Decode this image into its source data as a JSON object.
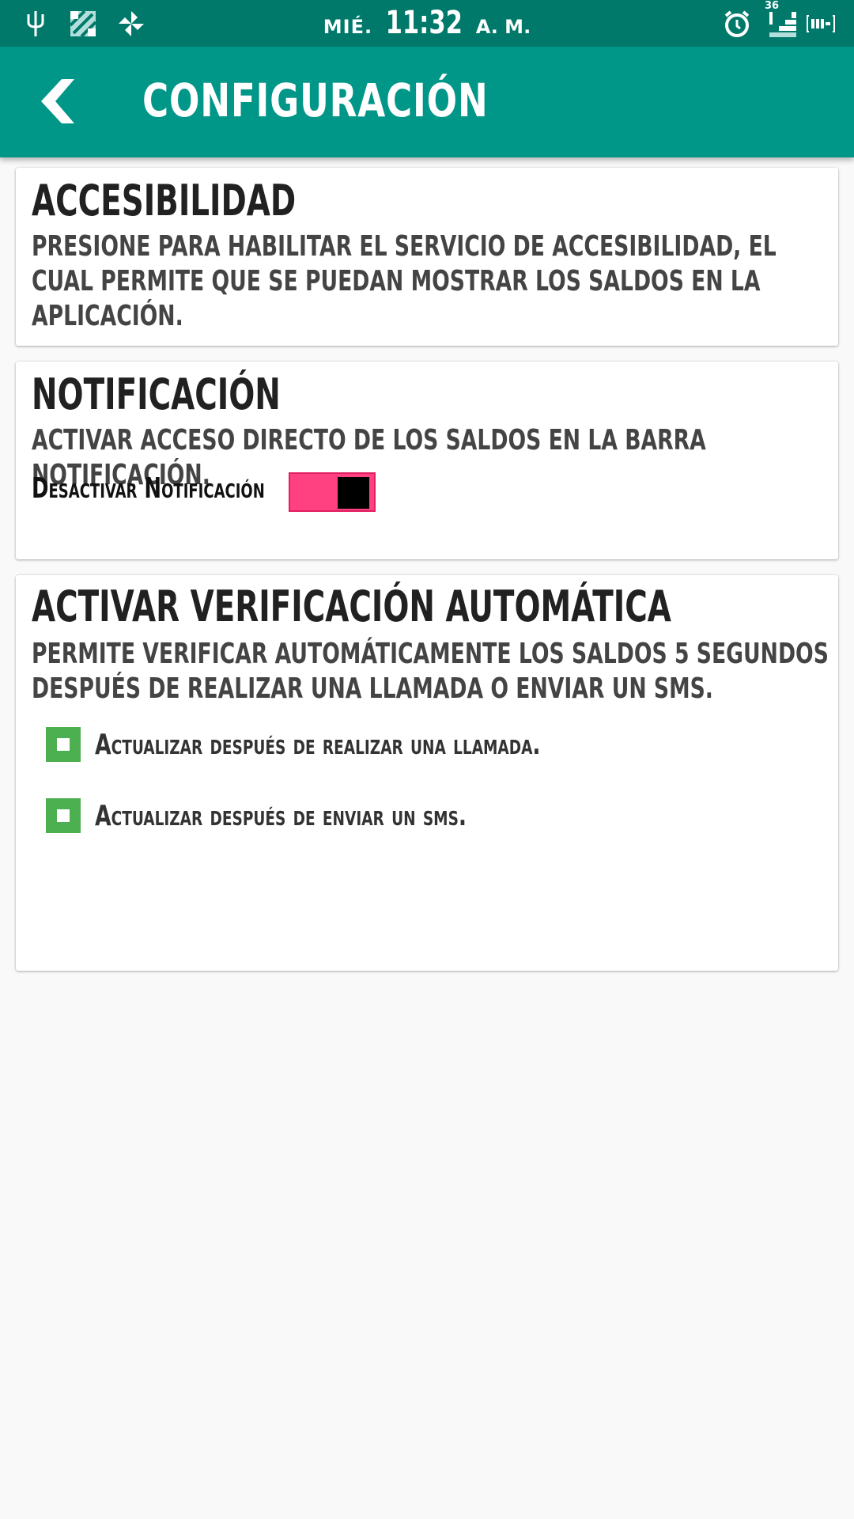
{
  "status_bar": {
    "day": "MIÉ.",
    "time": "11:32",
    "ampm": "A. M.",
    "signal_badge": "36",
    "icons": [
      "usb-icon",
      "screenshot-icon",
      "pinwheel-icon",
      "alarm-icon",
      "signal-icon",
      "battery-icon"
    ]
  },
  "app_bar": {
    "title": "CONFIGURACIÓN",
    "back_icon": "chevron-left-icon",
    "color": "#009688"
  },
  "accessibility": {
    "title": "ACCESIBILIDAD",
    "description": "Presione para habilitar el servicio de accesibilidad, el cual permite que se puedan mostrar los saldos en la aplicación."
  },
  "notification": {
    "title": "NOTIFICACIÓN",
    "description": "Activar acceso directo de los saldos en la barra notificación.",
    "switch_label": "Desactivar Notificación",
    "switch_on": true,
    "switch_color": "#ff4081"
  },
  "auto_check": {
    "title": "ACTIVAR VERIFICACIÓN AUTOMÁTICA",
    "description": "Permite verificar automáticamente los saldos 5 segundos después de realizar una llamada o enviar un sms.",
    "options": [
      {
        "label": "Actualizar después de realizar una llamada.",
        "checked": true
      },
      {
        "label": "Actualizar después de enviar un sms.",
        "checked": true
      }
    ],
    "checkbox_color": "#4caf50"
  }
}
